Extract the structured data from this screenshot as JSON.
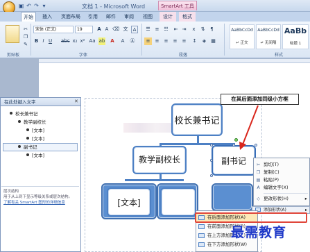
{
  "window": {
    "title": "文档 1 - Microsoft Word",
    "contextual_tab_group": "SmartArt 工具"
  },
  "tabs": [
    "开始",
    "插入",
    "页面布局",
    "引用",
    "邮件",
    "审阅",
    "视图",
    "设计",
    "格式"
  ],
  "ribbon": {
    "groups": {
      "clipboard": "剪贴板",
      "font": "字体",
      "paragraph": "段落",
      "styles": "样式"
    },
    "font_name": "宋体 (正文)",
    "font_size": "19",
    "styles": [
      {
        "sample": "AaBbCcDd",
        "name": "↵ 正文"
      },
      {
        "sample": "AaBbCcDd",
        "name": "↵ 无间隔"
      },
      {
        "sample": "AaBb",
        "name": "标题 1"
      }
    ]
  },
  "text_pane": {
    "title": "在此处键入文字",
    "items": [
      {
        "text": "校长兼书记",
        "level": 1
      },
      {
        "text": "教学副校长",
        "level": 2
      },
      {
        "text": "[文本]",
        "level": 3
      },
      {
        "text": "[文本]",
        "level": 3
      },
      {
        "text": "副书记",
        "level": 2
      },
      {
        "text": "[文本]",
        "level": 3
      }
    ],
    "footer_line1": "层次结构",
    "footer_line2": "用于从上到下显示等级关系或层次结构。",
    "footer_link": "了解有关 SmartArt 图形的详细信息"
  },
  "smartart": {
    "root": "校长兼书记",
    "child_left": "教学副校长",
    "child_right": "副书记",
    "grandchild_left": "[文本]"
  },
  "callout": "在其后面添加同级小方框",
  "context_menu": [
    {
      "label": "剪切(T)",
      "icon": "scissors-icon",
      "glyph": "✂"
    },
    {
      "label": "复制(C)",
      "icon": "copy-icon",
      "glyph": "❐"
    },
    {
      "label": "粘贴(P)",
      "icon": "paste-icon",
      "glyph": "📋"
    },
    {
      "label": "编辑文字(X)",
      "icon": "edit-text-icon",
      "glyph": "A"
    },
    {
      "label": "更改形状(H)",
      "icon": "change-shape-icon",
      "glyph": "◇"
    }
  ],
  "mini_toolbar_label": "添加形状(A)",
  "submenu": [
    {
      "label": "在后面添加形状(A)"
    },
    {
      "label": "在前面添加形状(B)"
    },
    {
      "label": "在上方添加形状(V)"
    },
    {
      "label": "在下方添加形状(W)"
    }
  ],
  "watermark": "最需教育"
}
